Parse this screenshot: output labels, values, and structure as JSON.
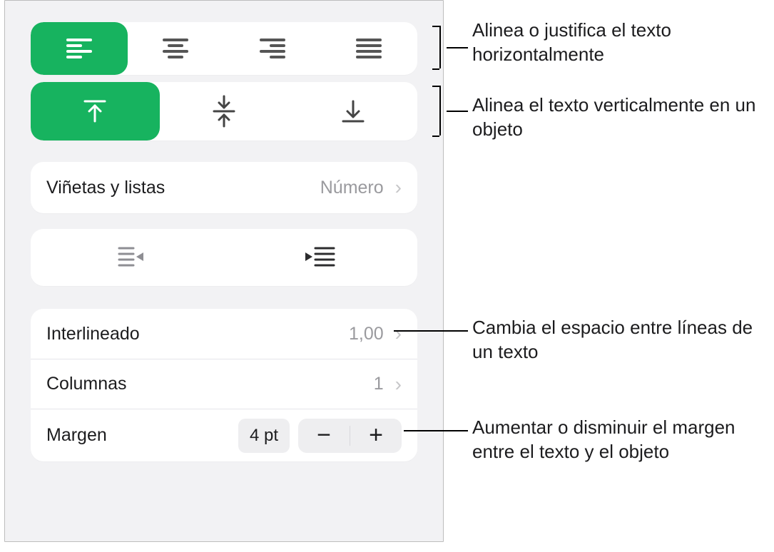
{
  "colors": {
    "accent": "#17b35f"
  },
  "halign": {
    "selected": "left",
    "options": [
      "left",
      "center",
      "right",
      "justify"
    ]
  },
  "valign": {
    "selected": "top",
    "options": [
      "top",
      "middle",
      "bottom"
    ]
  },
  "bullets": {
    "label": "Viñetas y listas",
    "value": "Número"
  },
  "indent": {
    "decrease": "outdent",
    "increase": "indent"
  },
  "spacing": {
    "line_label": "Interlineado",
    "line_value": "1,00",
    "columns_label": "Columnas",
    "columns_value": "1",
    "margin_label": "Margen",
    "margin_value": "4 pt"
  },
  "stepper": {
    "minus": "−",
    "plus": "+"
  },
  "callouts": {
    "halign": "Alinea o justifica el texto horizontalmente",
    "valign": "Alinea el texto verticalmente en un objeto",
    "line": "Cambia el espacio entre líneas de un texto",
    "margin": "Aumentar o disminuir el margen entre el texto y el objeto"
  }
}
